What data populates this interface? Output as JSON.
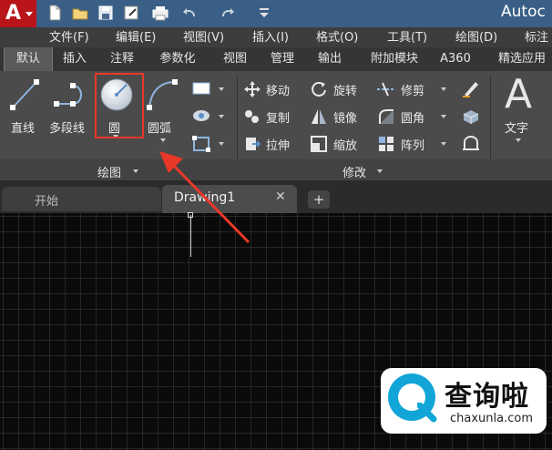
{
  "titlebar": {
    "app_logo": "A",
    "app_title": "Autoc",
    "quick_access_icons": [
      "new-icon",
      "open-icon",
      "save-icon",
      "saveas-icon",
      "print-icon",
      "undo-icon",
      "redo-icon",
      "customize-icon"
    ]
  },
  "menubar": {
    "items": [
      "文件(F)",
      "编辑(E)",
      "视图(V)",
      "插入(I)",
      "格式(O)",
      "工具(T)",
      "绘图(D)",
      "标注"
    ]
  },
  "ribbon_tabs": [
    "默认",
    "插入",
    "注释",
    "参数化",
    "视图",
    "管理",
    "输出",
    "附加模块",
    "A360",
    "精选应用"
  ],
  "draw_panel": {
    "line": "直线",
    "polyline": "多段线",
    "circle": "圆",
    "arc": "圆弧",
    "label": "绘图"
  },
  "modify_panel": {
    "move": "移动",
    "rotate": "旋转",
    "trim": "修剪",
    "copy": "复制",
    "mirror": "镜像",
    "fillet": "圆角",
    "stretch": "拉伸",
    "scale": "缩放",
    "array": "阵列",
    "label": "修改"
  },
  "annotation_panel": {
    "big_letter": "A",
    "text": "文字"
  },
  "file_tabs": {
    "start": "开始",
    "drawing": "Drawing1",
    "close": "✕",
    "new": "+"
  },
  "watermark": {
    "text": "查询啦",
    "url": "chaxunla.com"
  },
  "colors": {
    "highlight": "#e83828",
    "arrow": "#e83828",
    "title_bar": "#3a5f86",
    "app_button": "#b8141a"
  }
}
